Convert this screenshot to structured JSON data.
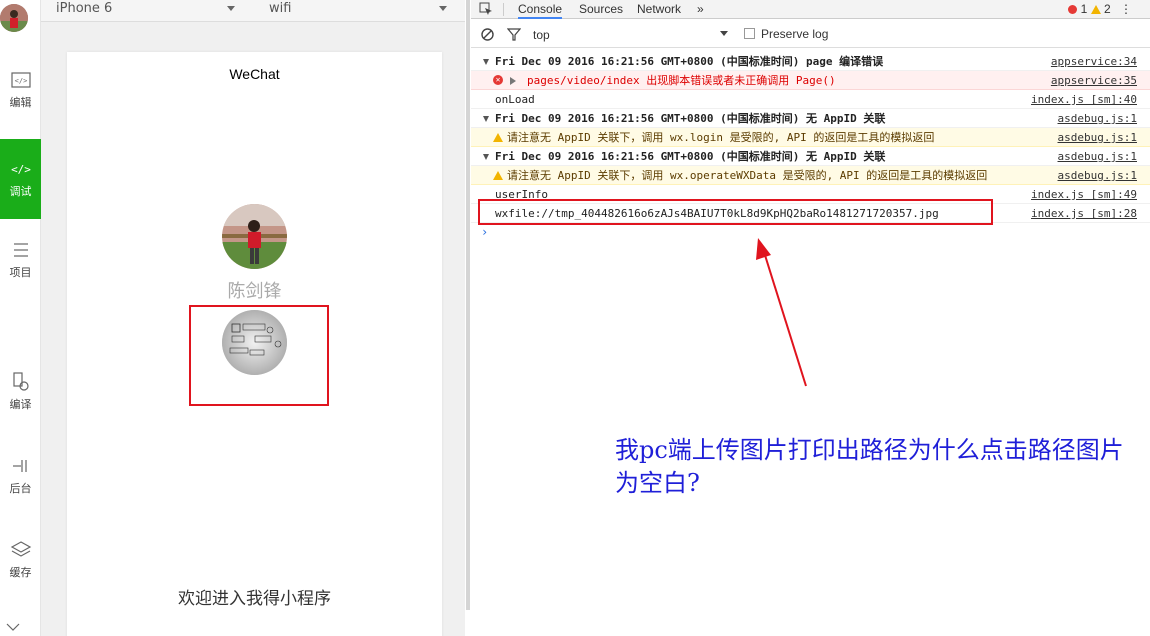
{
  "sidebar": {
    "items": [
      {
        "label": "编辑",
        "icon": "code-window-icon"
      },
      {
        "label": "调试",
        "icon": "debug-code-icon",
        "active": true
      },
      {
        "label": "项目",
        "icon": "menu-lines-icon"
      },
      {
        "label": "编译",
        "icon": "compile-icon"
      },
      {
        "label": "后台",
        "icon": "background-icon"
      },
      {
        "label": "缓存",
        "icon": "layers-icon"
      }
    ]
  },
  "simulator": {
    "device": "iPhone 6",
    "network": "wifi",
    "nav_title": "WeChat",
    "user_name": "陈剑锋",
    "welcome": "欢迎进入我得小程序"
  },
  "devtools": {
    "tabs": [
      "Console",
      "Sources",
      "Network",
      "»"
    ],
    "error_count": "1",
    "warning_count": "2",
    "context": "top",
    "preserve_log": "Preserve log",
    "logs": [
      {
        "type": "group",
        "text": "Fri Dec 09 2016 16:21:56 GMT+0800 (中国标准时间) page 编译错误",
        "source": "appservice:34"
      },
      {
        "type": "error",
        "text": "pages/video/index 出现脚本错误或者未正确调用 Page()",
        "source": "appservice:35"
      },
      {
        "type": "log",
        "text": "onLoad",
        "source": "index.js [sm]:40"
      },
      {
        "type": "group",
        "text": "Fri Dec 09 2016 16:21:56 GMT+0800 (中国标准时间) 无 AppID 关联",
        "source": "asdebug.js:1"
      },
      {
        "type": "warn",
        "text": "请注意无 AppID 关联下，调用 wx.login 是受限的, API 的返回是工具的模拟返回",
        "source": "asdebug.js:1"
      },
      {
        "type": "group",
        "text": "Fri Dec 09 2016 16:21:56 GMT+0800 (中国标准时间) 无 AppID 关联",
        "source": "asdebug.js:1"
      },
      {
        "type": "warn",
        "text": "请注意无 AppID 关联下，调用 wx.operateWXData 是受限的, API 的返回是工具的模拟返回",
        "source": "asdebug.js:1"
      },
      {
        "type": "log",
        "text": "userInfo",
        "source": "index.js [sm]:49"
      },
      {
        "type": "log",
        "text": "wxfile://tmp_404482616o6zAJs4BAIU7T0kL8d9KpHQ2baRo1481271720357.jpg",
        "source": "index.js [sm]:28"
      }
    ],
    "prompt": "›"
  },
  "annotation": {
    "text": "我pc端上传图片打印出路径为什么点击路径图片为空白?"
  },
  "colors": {
    "active_green": "#1aad19",
    "error_red": "#e53935",
    "warn_yellow": "#f2b400",
    "highlight_red": "#e0141e",
    "annotation_blue": "#1f1fd8"
  }
}
